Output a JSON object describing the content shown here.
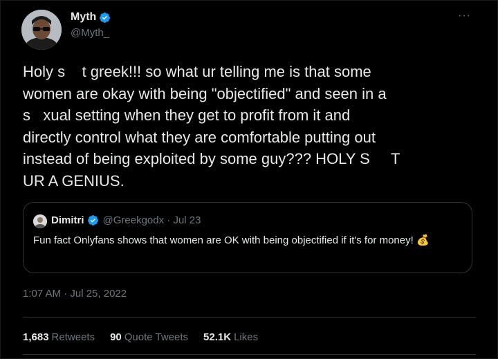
{
  "author": {
    "display_name": "Myth",
    "handle": "@Myth_"
  },
  "more_label": "···",
  "tweet_text": "Holy s    t greek!!! so what ur telling me is that some\nwomen are okay with being \"objectified\" and seen in a\ns   xual setting when they get to profit from it and\ndirectly control what they are comfortable putting out\ninstead of being exploited by some guy??? HOLY S     T\nUR A GENIUS.",
  "quote": {
    "display_name": "Dimitri",
    "handle_time": "@Greekgodx · Jul 23",
    "text": "Fun fact Onlyfans shows that women are OK with being objectified if it's for money!",
    "emoji": "💰"
  },
  "timestamp": "1:07 AM · Jul 25, 2022",
  "stats": {
    "retweets_count": "1,683",
    "retweets_label": "Retweets",
    "quotes_count": "90",
    "quotes_label": "Quote Tweets",
    "likes_count": "52.1K",
    "likes_label": "Likes"
  },
  "colors": {
    "background": "#000000",
    "text": "#e7e9ea",
    "secondary": "#71767b",
    "verified": "#1d9bf0",
    "divider": "#2f3336"
  }
}
